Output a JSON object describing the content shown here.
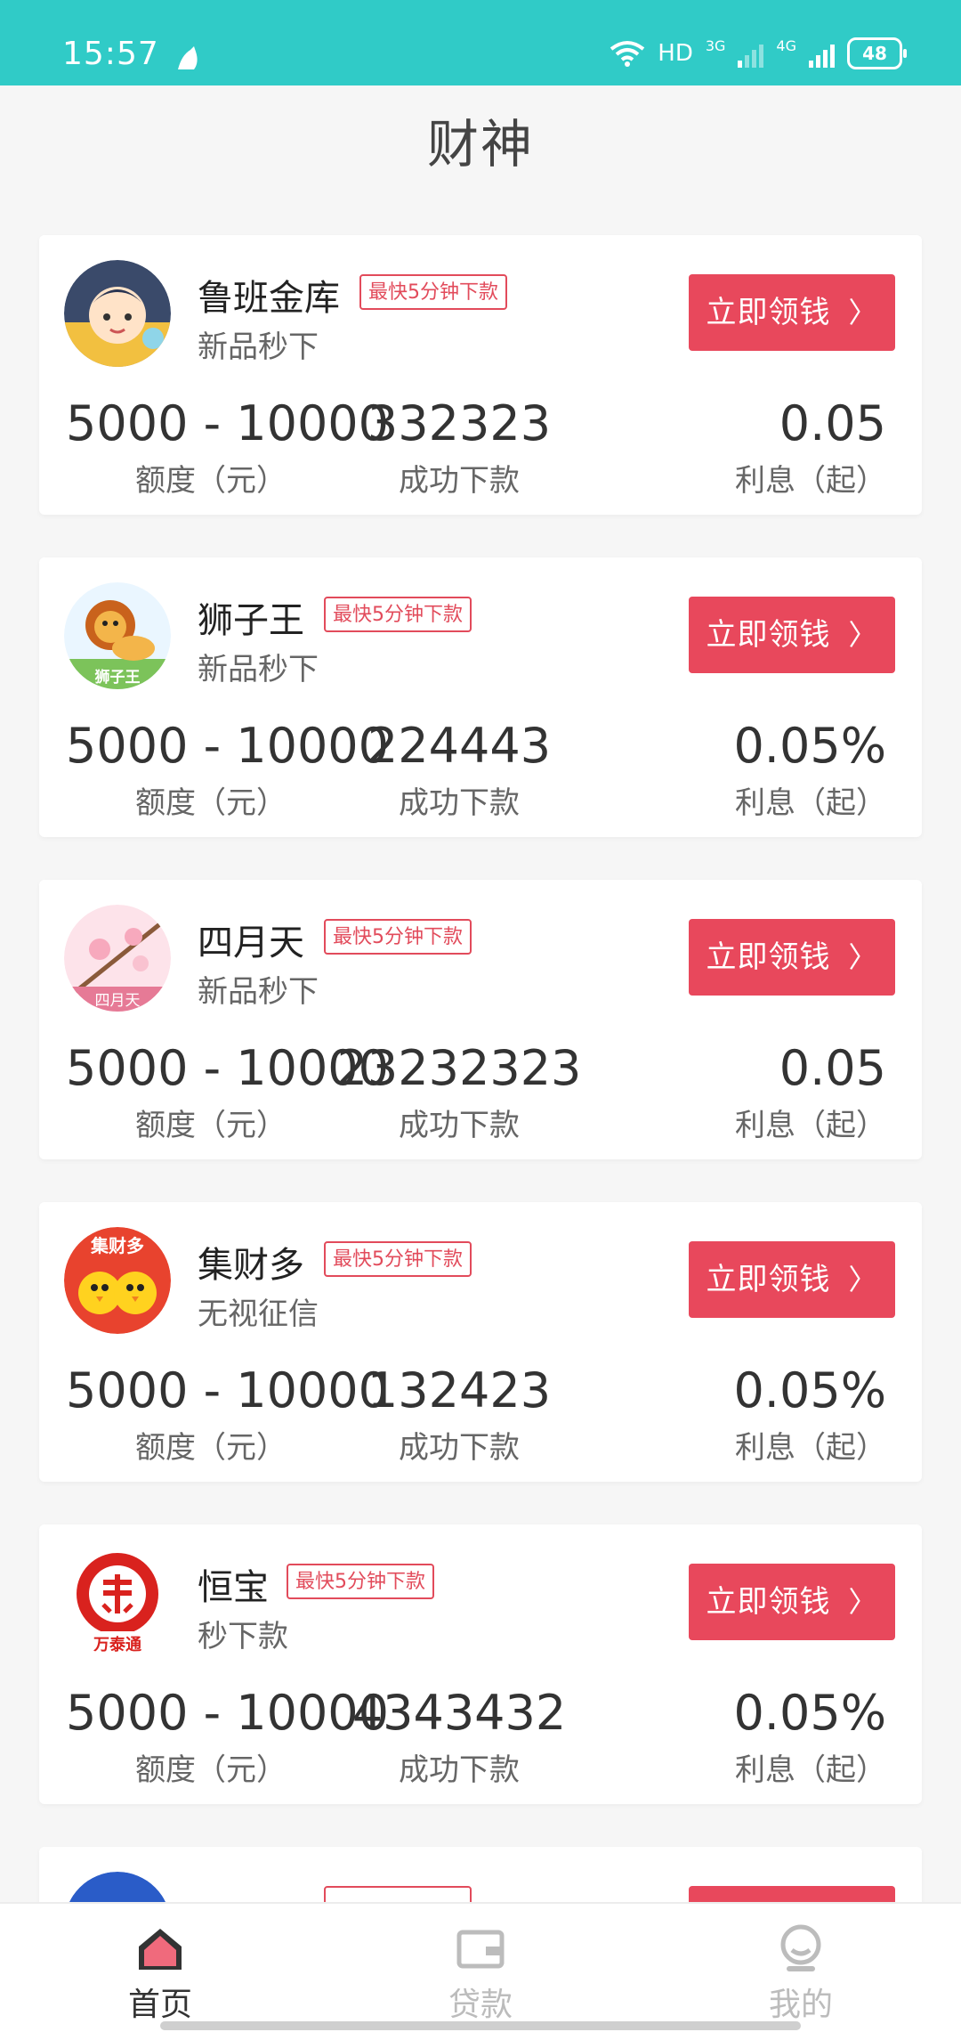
{
  "status": {
    "time": "15:57",
    "network": "HD",
    "net1": "3G",
    "net2": "4G",
    "battery": "48"
  },
  "header": {
    "title": "财神"
  },
  "colors": {
    "accent": "#e8485c",
    "status_bar": "#30cbc7"
  },
  "cards": [
    {
      "name": "鲁班金库",
      "tag": "最快5分钟下款",
      "sub": "新品秒下",
      "cta": "立即领钱",
      "amount": "5000 - 10000",
      "amount_label": "额度（元）",
      "success": "332323",
      "success_label": "成功下款",
      "rate": "0.05",
      "rate_label": "利息（起）",
      "logo_icon": "cartoon-girl-logo"
    },
    {
      "name": "狮子王",
      "tag": "最快5分钟下款",
      "sub": "新品秒下",
      "cta": "立即领钱",
      "amount": "5000 - 10000",
      "amount_label": "额度（元）",
      "success": "224443",
      "success_label": "成功下款",
      "rate": "0.05%",
      "rate_label": "利息（起）",
      "logo_icon": "lion-logo",
      "logo_text": "狮子王"
    },
    {
      "name": "四月天",
      "tag": "最快5分钟下款",
      "sub": "新品秒下",
      "cta": "立即领钱",
      "amount": "5000 - 10000",
      "amount_label": "额度（元）",
      "success": "23232323",
      "success_label": "成功下款",
      "rate": "0.05",
      "rate_label": "利息（起）",
      "logo_icon": "blossom-logo",
      "logo_text": "四月天"
    },
    {
      "name": "集财多",
      "tag": "最快5分钟下款",
      "sub": "无视征信",
      "cta": "立即领钱",
      "amount": "5000 - 10000",
      "amount_label": "额度（元）",
      "success": "132423",
      "success_label": "成功下款",
      "rate": "0.05%",
      "rate_label": "利息（起）",
      "logo_icon": "chicks-logo",
      "logo_text": "集财多"
    },
    {
      "name": "恒宝",
      "tag": "最快5分钟下款",
      "sub": "秒下款",
      "cta": "立即领钱",
      "amount": "5000 - 10000",
      "amount_label": "额度（元）",
      "success": "4343432",
      "success_label": "成功下款",
      "rate": "0.05%",
      "rate_label": "利息（起）",
      "logo_icon": "seal-logo",
      "logo_text": "万泰通"
    }
  ],
  "partial_card": {
    "name": "",
    "tag": "",
    "cta": ""
  },
  "nav": [
    {
      "label": "首页",
      "icon": "home-icon",
      "active": true
    },
    {
      "label": "贷款",
      "icon": "wallet-icon",
      "active": false
    },
    {
      "label": "我的",
      "icon": "profile-icon",
      "active": false
    }
  ]
}
